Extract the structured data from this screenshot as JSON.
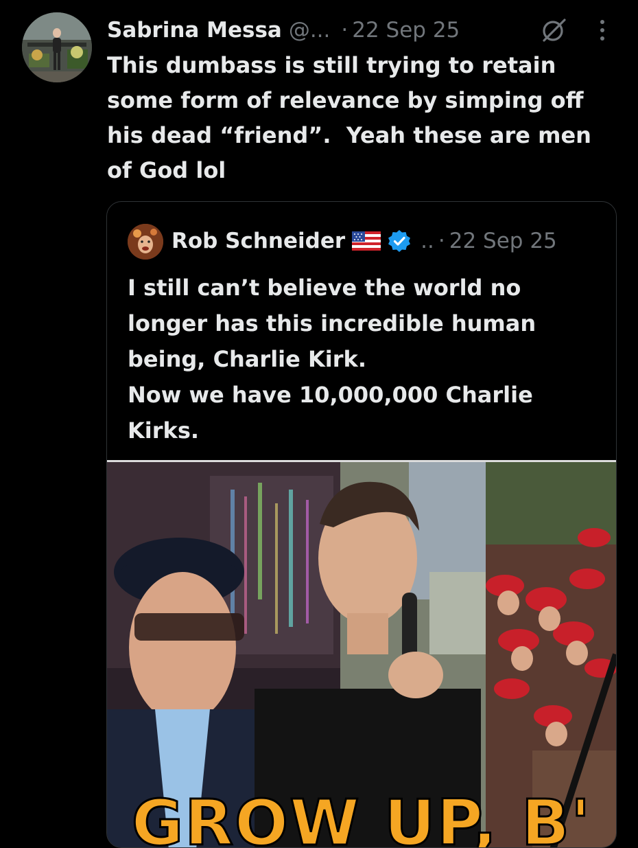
{
  "tweet": {
    "display_name": "Sabrina Messa",
    "handle": "@...",
    "separator": "·",
    "date": "22 Sep 25",
    "text": "This dumbass is still trying to retain\nsome form of relevance by simping off\nhis dead “friend”.  Yeah these are men\nof God lol",
    "icons": {
      "avatar": "profile-photo",
      "grok": "grok-icon",
      "more": "more-options-icon"
    }
  },
  "quoted_tweet": {
    "display_name": "Rob Schneider",
    "handle": "..",
    "separator": "·",
    "date": "22 Sep 25",
    "text": "I still can’t believe the world no\nlonger has this incredible human\nbeing, Charlie Kirk.\nNow we have 10,000,000 Charlie\nKirks.",
    "icons": {
      "flag": "us-flag-icon",
      "verified": "verified-badge-icon"
    },
    "media": {
      "caption": "GROW UP, B'"
    }
  },
  "colors": {
    "background": "#000000",
    "text": "#e7e9ea",
    "muted": "#71767b",
    "border": "#2f3336",
    "verified": "#1d9bf0",
    "caption": "#f5a623"
  }
}
